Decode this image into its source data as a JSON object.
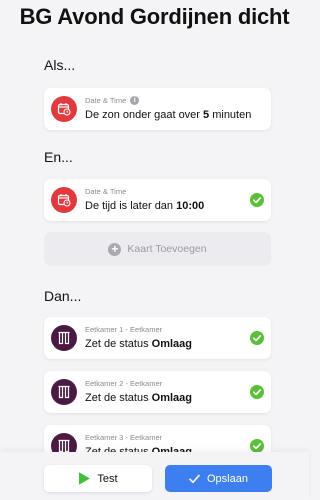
{
  "title": "BG Avond Gordijnen dicht",
  "sections": {
    "als": "Als...",
    "en": "En...",
    "dan": "Dan..."
  },
  "colors": {
    "datetime_red": "#e0393e",
    "device_purple": "#4a1a45",
    "check_green": "#5bbf3a",
    "save_blue": "#3d7ef0",
    "play_green": "#3fbf3a"
  },
  "when_card": {
    "source": "Date & Time",
    "text_prefix": "De zon onder gaat over ",
    "text_bold": "5",
    "text_suffix": " minuten",
    "icon": "calendar-clock-icon"
  },
  "and_card": {
    "source": "Date & Time",
    "text_prefix": "De tijd is later dan ",
    "text_bold": "10:00",
    "icon": "calendar-clock-icon"
  },
  "add_card": {
    "label": "Kaart Toevoegen"
  },
  "then_cards": [
    {
      "source": "Eetkamer 1 - Eetkamer",
      "text_prefix": "Zet de status ",
      "text_bold": "Omlaag",
      "icon": "curtains-icon"
    },
    {
      "source": "Eetkamer 2 - Eetkamer",
      "text_prefix": "Zet de status ",
      "text_bold": "Omlaag",
      "icon": "curtains-icon"
    },
    {
      "source": "Eetkamer 3 - Eetkamer",
      "text_prefix": "Zet de status ",
      "text_bold": "Omlaag",
      "icon": "curtains-icon"
    }
  ],
  "buttons": {
    "test": "Test",
    "save": "Opslaan"
  }
}
